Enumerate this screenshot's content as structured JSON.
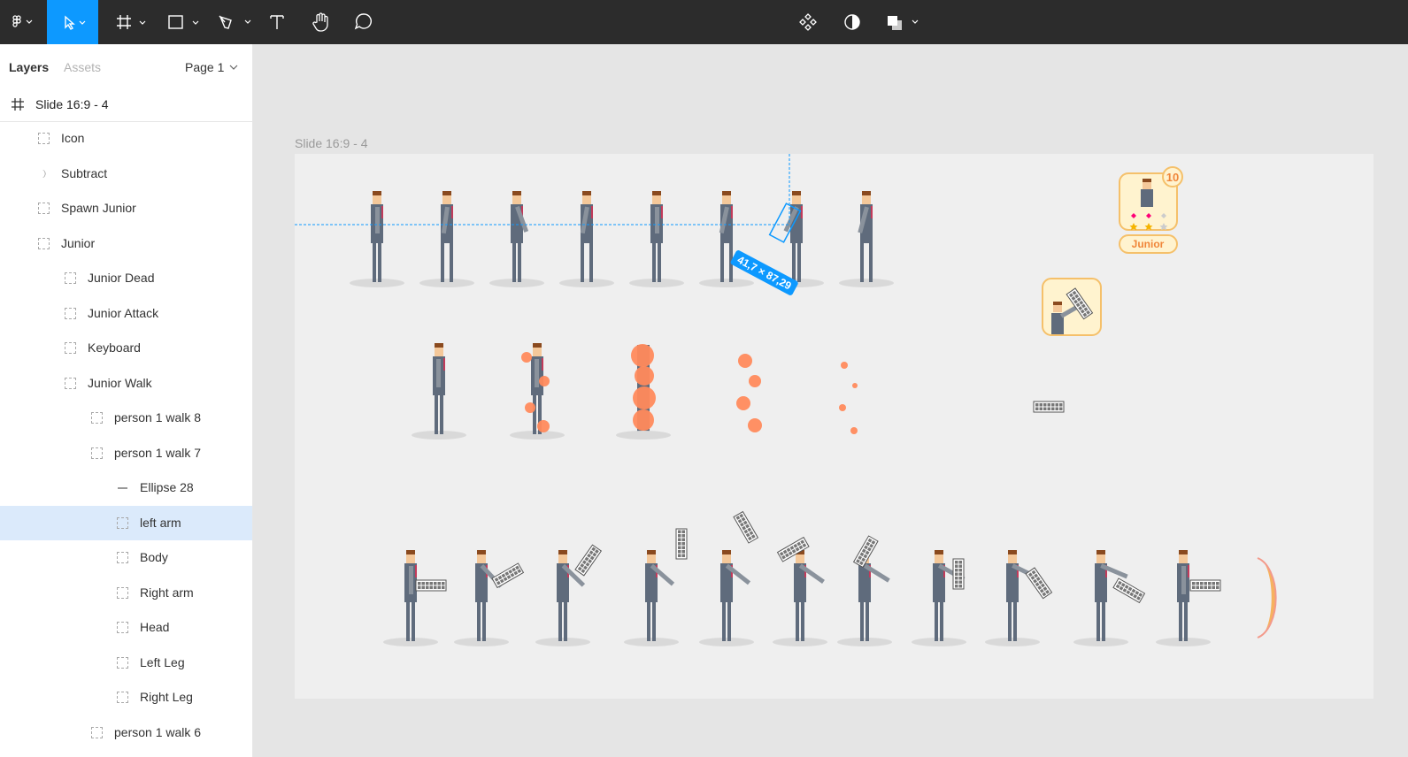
{
  "toolbar": {
    "tools": [
      "main-menu",
      "move",
      "frame",
      "shape",
      "pen",
      "text",
      "hand",
      "comment"
    ],
    "center_tools": [
      "components",
      "contrast",
      "boolean"
    ],
    "accent": "#0d99ff"
  },
  "sidebar": {
    "tab_layers": "Layers",
    "tab_assets": "Assets",
    "page_label": "Page 1",
    "frame_name": "Slide 16:9 - 4",
    "layers": [
      {
        "label": "Icon"
      },
      {
        "label": "Subtract"
      },
      {
        "label": "Spawn Junior"
      },
      {
        "label": "Junior"
      },
      {
        "label": "Junior Dead"
      },
      {
        "label": "Junior Attack"
      },
      {
        "label": "Keyboard"
      },
      {
        "label": "Junior Walk"
      },
      {
        "label": "person 1 walk 8"
      },
      {
        "label": "person 1 walk 7"
      },
      {
        "label": "Ellipse 28"
      },
      {
        "label": "left arm"
      },
      {
        "label": "Body"
      },
      {
        "label": "Right arm"
      },
      {
        "label": "Head"
      },
      {
        "label": "Left Leg"
      },
      {
        "label": "Right Leg"
      },
      {
        "label": "person 1 walk 6"
      }
    ]
  },
  "canvas": {
    "frame_label": "Slide 16:9 - 4",
    "measure_label": "41,7 × 87,29",
    "icon_badge_count": "10",
    "icon_name_label": "Junior",
    "colors": {
      "suit": "#5f6b7c",
      "arm": "#8a929c",
      "skin": "#f4c89a",
      "hair": "#8a4a1f",
      "blood": "#ff8a5c",
      "card_bg": "#fff3cf",
      "card_border": "#f5c06a",
      "selection": "#0d99ff"
    }
  }
}
